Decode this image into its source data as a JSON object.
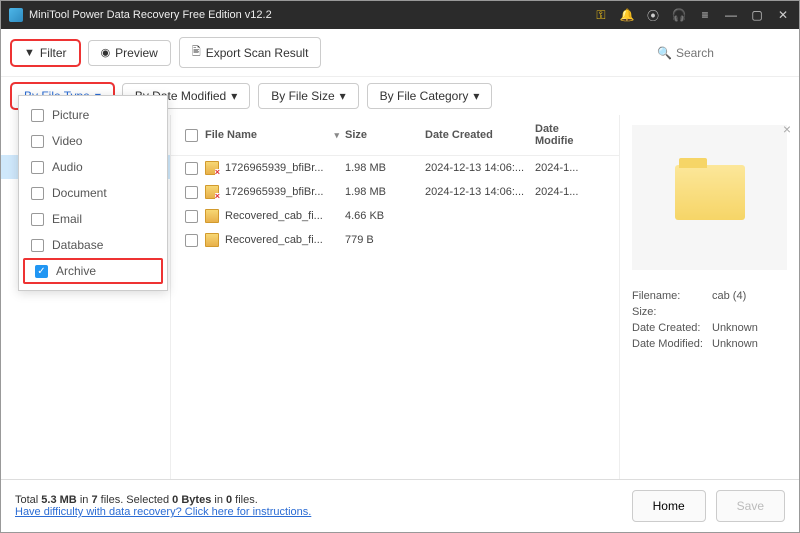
{
  "title": "MiniTool Power Data Recovery Free Edition v12.2",
  "toolbar": {
    "filter": "Filter",
    "preview": "Preview",
    "export": "Export Scan Result",
    "search_placeholder": "Search"
  },
  "filters": {
    "by_type": "By File Type",
    "by_date": "By Date Modified",
    "by_size": "By File Size",
    "by_category": "By File Category"
  },
  "type_menu": [
    {
      "label": "Picture",
      "checked": false
    },
    {
      "label": "Video",
      "checked": false
    },
    {
      "label": "Audio",
      "checked": false
    },
    {
      "label": "Document",
      "checked": false
    },
    {
      "label": "Email",
      "checked": false
    },
    {
      "label": "Database",
      "checked": false
    },
    {
      "label": "Archive",
      "checked": true
    }
  ],
  "columns": {
    "name": "File Name",
    "size": "Size",
    "created": "Date Created",
    "modified": "Date Modifie"
  },
  "rows": [
    {
      "name": "1726965939_bfiBr...",
      "size": "1.98 MB",
      "created": "2024-12-13 14:06:...",
      "modified": "2024-1...",
      "bad": true
    },
    {
      "name": "1726965939_bfiBr...",
      "size": "1.98 MB",
      "created": "2024-12-13 14:06:...",
      "modified": "2024-1...",
      "bad": true
    },
    {
      "name": "Recovered_cab_fi...",
      "size": "4.66 KB",
      "created": "",
      "modified": "",
      "bad": false
    },
    {
      "name": "Recovered_cab_fi...",
      "size": "779 B",
      "created": "",
      "modified": "",
      "bad": false
    }
  ],
  "preview": {
    "filename_lbl": "Filename:",
    "filename_val": "cab (4)",
    "size_lbl": "Size:",
    "size_val": "",
    "created_lbl": "Date Created:",
    "created_val": "Unknown",
    "modified_lbl": "Date Modified:",
    "modified_val": "Unknown"
  },
  "footer": {
    "summary_prefix": "Total ",
    "summary_total": "5.3 MB",
    "summary_in": " in ",
    "summary_files": "7",
    "summary_files_suffix": " files.  Selected ",
    "summary_selected": "0 Bytes",
    "summary_in2": " in ",
    "summary_sel_files": "0",
    "summary_end": " files.",
    "help": "Have difficulty with data recovery? Click here for instructions.",
    "home": "Home",
    "save": "Save"
  }
}
